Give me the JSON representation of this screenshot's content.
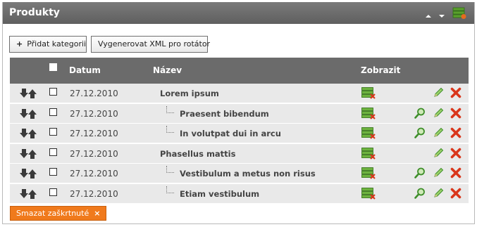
{
  "panel": {
    "title": "Produkty",
    "icons": [
      "collapse-up",
      "collapse-down",
      "grid-settings"
    ]
  },
  "toolbar": {
    "add_category_label": "Přidat kategorii",
    "generate_xml_label": "Vygenerovat XML pro rotátor"
  },
  "table": {
    "headers": {
      "date": "Datum",
      "name": "Název",
      "show": "Zobrazit"
    },
    "rows": [
      {
        "date": "27.12.2010",
        "name": "Lorem ipsum",
        "level": 0,
        "has_detail": false
      },
      {
        "date": "27.12.2010",
        "name": "Praesent bibendum",
        "level": 1,
        "has_detail": true
      },
      {
        "date": "27.12.2010",
        "name": "In volutpat dui in arcu",
        "level": 1,
        "has_detail": true
      },
      {
        "date": "27.12.2010",
        "name": "Phasellus mattis",
        "level": 0,
        "has_detail": false
      },
      {
        "date": "27.12.2010",
        "name": "Vestibulum a metus non risus",
        "level": 1,
        "has_detail": true
      },
      {
        "date": "27.12.2010",
        "name": "Etiam vestibulum",
        "level": 1,
        "has_detail": true
      }
    ]
  },
  "footer": {
    "delete_checked_label": "Smazat zaškrtnuté"
  },
  "colors": {
    "header_bg": "#6b6b6b",
    "row_bg": "#e9e9e9",
    "accent_orange": "#f07a1c",
    "delete_red": "#d9361b",
    "edit_green": "#3f8f2a"
  }
}
